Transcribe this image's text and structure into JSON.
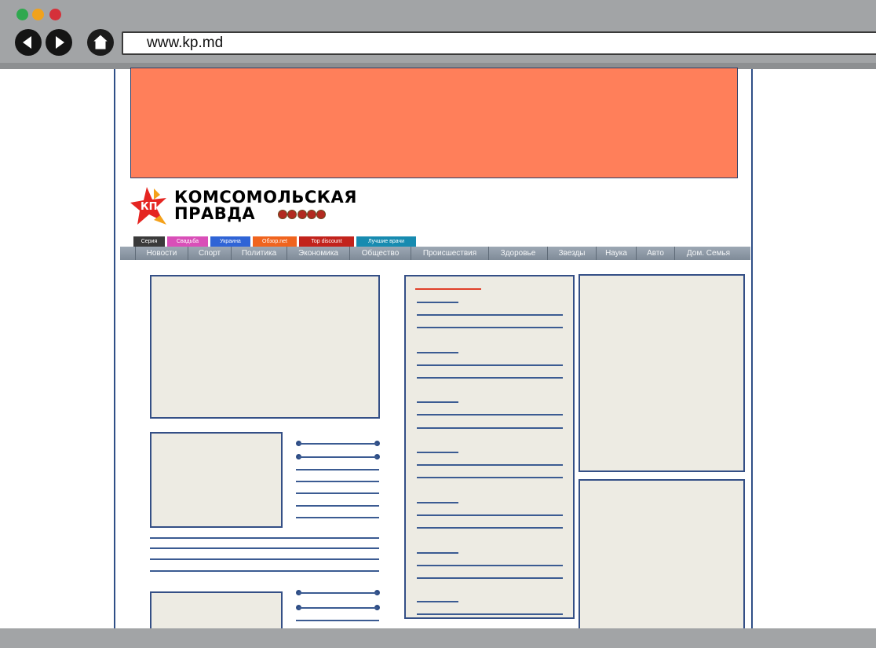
{
  "browser": {
    "url": "www.kp.md",
    "traffic_lights": [
      "#2fa84f",
      "#f0a21c",
      "#d5303a"
    ],
    "icons": [
      "back-arrow-icon",
      "forward-arrow-icon",
      "home-icon"
    ]
  },
  "logo": {
    "line1": "КОМСОМОЛЬСКАЯ",
    "line2": "ПРАВДА",
    "badge": "КП"
  },
  "colored_tabs": [
    {
      "label": "Серия",
      "color": "#3a3a3a"
    },
    {
      "label": "Свадьба",
      "color": "#d94fb8"
    },
    {
      "label": "Украина",
      "color": "#2f64d6"
    },
    {
      "label": "Обзор.net",
      "color": "#f0641e"
    },
    {
      "label": "Top discount",
      "color": "#c2231c"
    },
    {
      "label": "Лучшие врачи",
      "color": "#178bb0"
    }
  ],
  "main_nav": [
    "Новости",
    "Спорт",
    "Политика",
    "Экономика",
    "Общество",
    "Происшествия",
    "Здоровье",
    "Звезды",
    "Наука",
    "Авто",
    "Дом. Семья"
  ],
  "colors": {
    "ad_banner": "#ff7f5a",
    "content_box": "#edebe3",
    "border": "#344f86",
    "accent_line": "#e0402a"
  }
}
